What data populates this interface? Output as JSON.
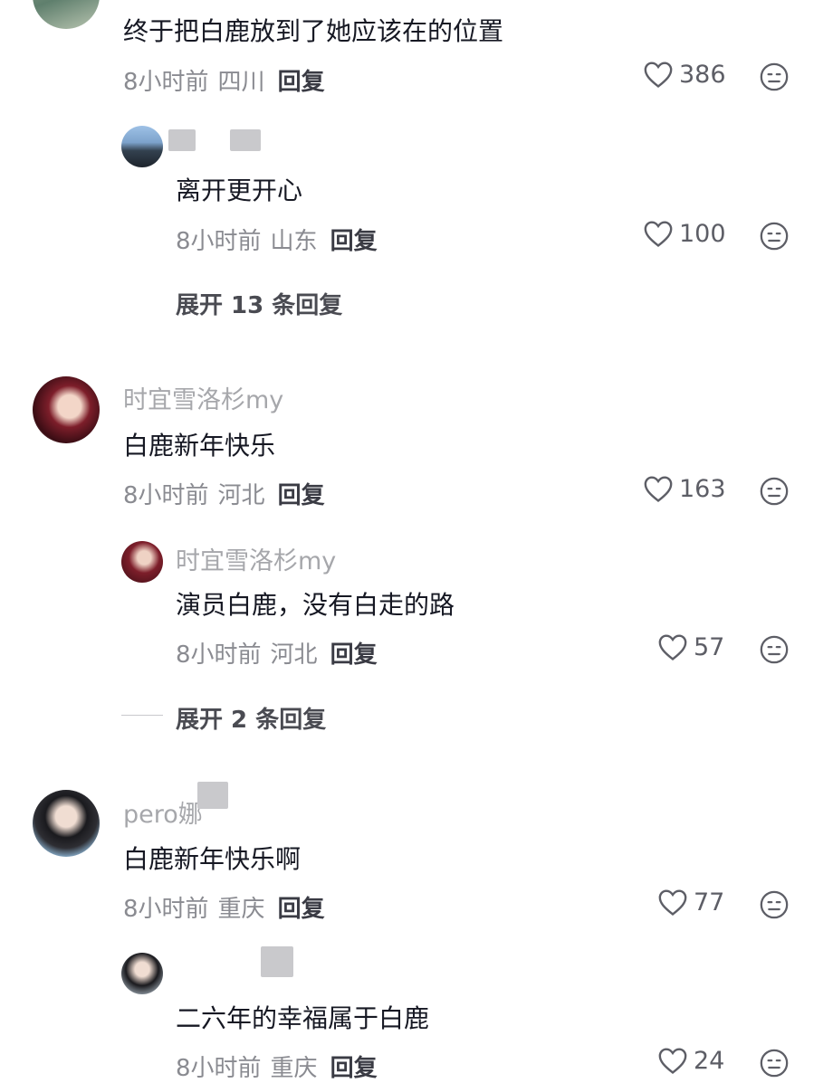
{
  "colors": {
    "text_primary": "#161823",
    "text_secondary": "#8a8b91",
    "username": "#a6a7ab",
    "blur_mask": "#c9c9cc"
  },
  "comments": [
    {
      "text": "终于把白鹿放到了她应该在的位置",
      "time": "8小时前",
      "location": "四川",
      "reply_label": "回复",
      "likes": "386",
      "replies": [
        {
          "text": "离开更开心",
          "time": "8小时前",
          "location": "山东",
          "reply_label": "回复",
          "likes": "100"
        }
      ],
      "expand_label": "展开 13 条回复"
    },
    {
      "username": "时宜雪洛杉my",
      "text": "白鹿新年快乐",
      "time": "8小时前",
      "location": "河北",
      "reply_label": "回复",
      "likes": "163",
      "replies": [
        {
          "username": "时宜雪洛杉my",
          "text": "演员白鹿，没有白走的路",
          "time": "8小时前",
          "location": "河北",
          "reply_label": "回复",
          "likes": "57"
        }
      ],
      "expand_label": "展开 2 条回复"
    },
    {
      "username": "pero娜",
      "text": "白鹿新年快乐啊",
      "time": "8小时前",
      "location": "重庆",
      "reply_label": "回复",
      "likes": "77",
      "replies": [
        {
          "text": "二六年的幸福属于白鹿",
          "time": "8小时前",
          "location": "重庆",
          "reply_label": "回复",
          "likes": "24"
        }
      ]
    }
  ]
}
